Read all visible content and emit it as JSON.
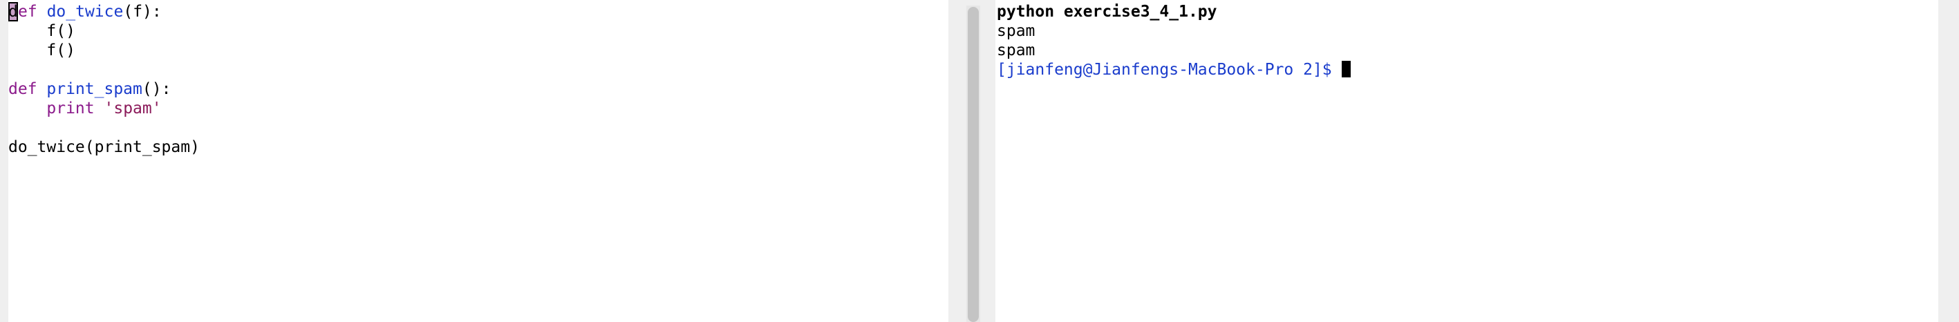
{
  "editor": {
    "lines": {
      "l1": {
        "cursor_char": "d",
        "kw": "ef",
        "sp": " ",
        "fn": "do_twice",
        "rest": "(f):"
      },
      "l2": {
        "text": "    f()"
      },
      "l3": {
        "text": "    f()"
      },
      "l5": {
        "kw": "def",
        "sp": " ",
        "fn": "print_spam",
        "rest": "():"
      },
      "l6": {
        "indent": "    ",
        "kw": "print",
        "sp": " ",
        "str": "'spam'"
      },
      "l8": {
        "text": "do_twice(print_spam)"
      }
    }
  },
  "terminal": {
    "command": "python exercise3_4_1.py",
    "output": [
      "spam",
      "spam"
    ],
    "prompt": "[jianfeng@Jianfengs-MacBook-Pro 2]$ "
  },
  "colors": {
    "keyword": "#8b1a8b",
    "function_name": "#1a3ccc",
    "string": "#8b1a5a",
    "prompt": "#1a3ccc"
  }
}
